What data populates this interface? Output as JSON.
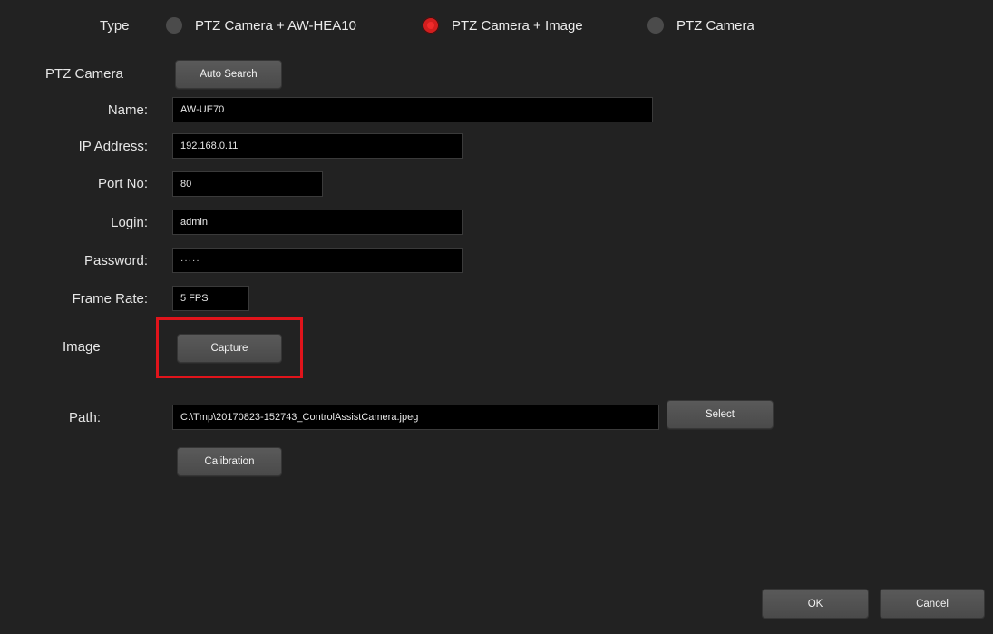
{
  "type_row": {
    "label": "Type",
    "options": [
      {
        "label": "PTZ Camera + AW-HEA10",
        "selected": false
      },
      {
        "label": "PTZ Camera + Image",
        "selected": true
      },
      {
        "label": "PTZ Camera",
        "selected": false
      }
    ]
  },
  "ptz_camera": {
    "label": "PTZ Camera",
    "auto_search_label": "Auto Search"
  },
  "fields": {
    "name": {
      "label": "Name:",
      "value": "AW-UE70"
    },
    "ip": {
      "label": "IP Address:",
      "value": "192.168.0.11"
    },
    "port": {
      "label": "Port No:",
      "value": "80"
    },
    "login": {
      "label": "Login:",
      "value": "admin"
    },
    "password": {
      "label": "Password:",
      "value": "·····"
    },
    "frame_rate": {
      "label": "Frame Rate:",
      "value": "5 FPS"
    }
  },
  "image": {
    "label": "Image",
    "capture_label": "Capture"
  },
  "path": {
    "label": "Path:",
    "value": "C:\\Tmp\\20170823-152743_ControlAssistCamera.jpeg",
    "select_label": "Select"
  },
  "calibration_label": "Calibration",
  "footer": {
    "ok_label": "OK",
    "cancel_label": "Cancel"
  },
  "colors": {
    "background": "#222222",
    "selected_radio": "#d21e1e",
    "highlight_box": "#e0141b"
  }
}
